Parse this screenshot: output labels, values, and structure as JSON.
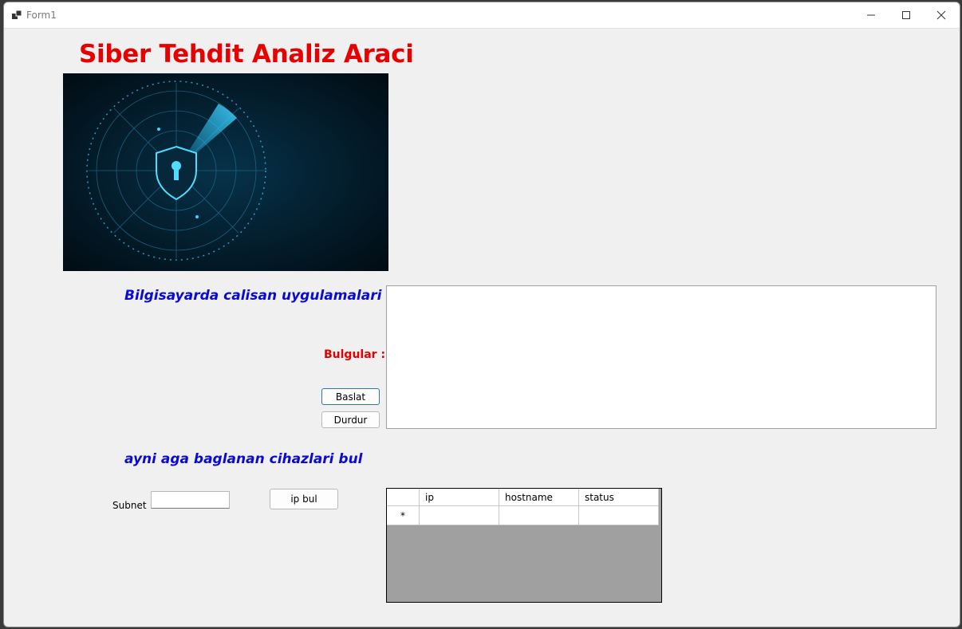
{
  "window": {
    "title": "Form1"
  },
  "main": {
    "title": "Siber Tehdit Analiz Araci",
    "section1_label": "Bilgisayarda calisan uygulamalari bul",
    "findings_label": "Bulgular :",
    "start_button": "Baslat",
    "stop_button": "Durdur",
    "section2_label": "ayni aga baglanan cihazlari bul",
    "subnet_label": "Subnet",
    "subnet_value": "",
    "ip_button": "ip bul",
    "grid": {
      "columns": [
        "ip",
        "hostname",
        "status"
      ],
      "new_row_marker": "*"
    }
  },
  "colors": {
    "title_red": "#e60000",
    "section_blue": "#0a0ad2",
    "grid_bg": "#a0a0a0"
  },
  "icons": [
    "app-icon",
    "minimize-icon",
    "maximize-icon",
    "close-icon",
    "shield-lock-icon"
  ]
}
